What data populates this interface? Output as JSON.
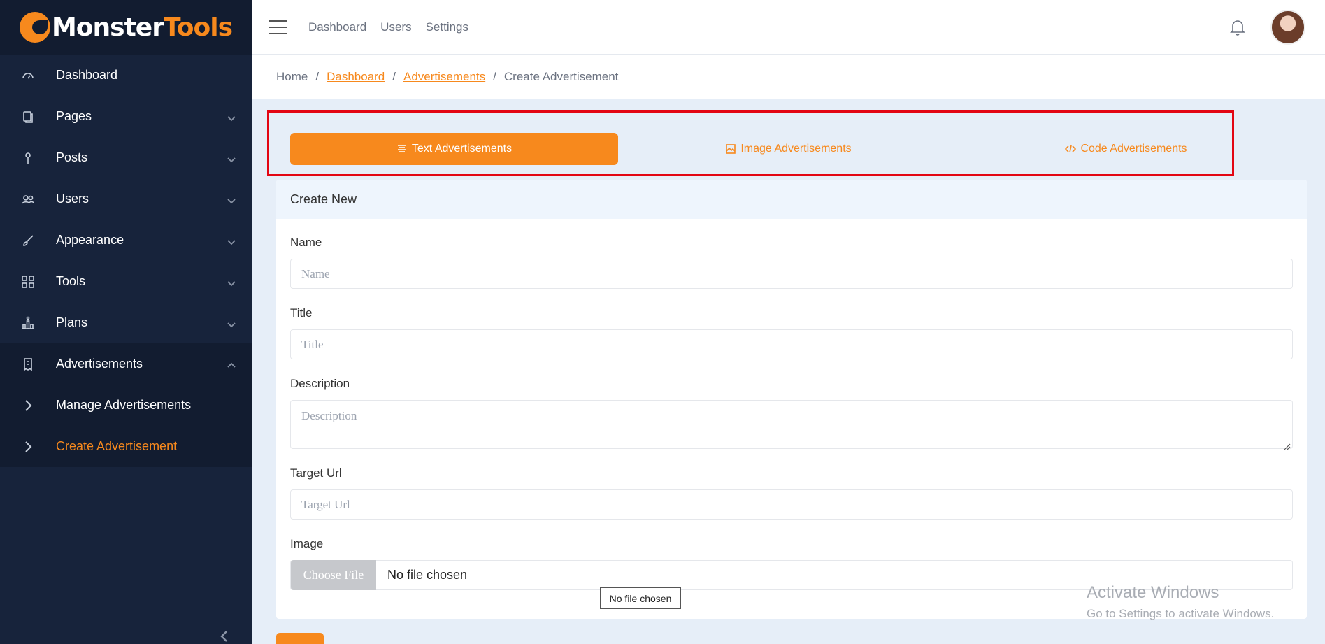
{
  "brand": {
    "part1": "Monster",
    "part2": "Tools"
  },
  "sidebar": {
    "items": [
      {
        "label": "Dashboard",
        "icon": "dashboard-icon"
      },
      {
        "label": "Pages",
        "icon": "pages-icon"
      },
      {
        "label": "Posts",
        "icon": "posts-icon"
      },
      {
        "label": "Users",
        "icon": "users-icon"
      },
      {
        "label": "Appearance",
        "icon": "brush-icon"
      },
      {
        "label": "Tools",
        "icon": "grid-icon"
      },
      {
        "label": "Plans",
        "icon": "plans-icon"
      },
      {
        "label": "Advertisements",
        "icon": "receipt-icon"
      }
    ],
    "sub_items": [
      {
        "label": "Manage Advertisements"
      },
      {
        "label": "Create Advertisement"
      }
    ]
  },
  "topbar": {
    "links": [
      "Dashboard",
      "Users",
      "Settings"
    ]
  },
  "breadcrumb": {
    "home": "Home",
    "dashboard": "Dashboard",
    "ads": "Advertisements",
    "current": "Create Advertisement",
    "separator": "/"
  },
  "tabs": [
    {
      "label": "Text Advertisements",
      "active": true
    },
    {
      "label": "Image Advertisements",
      "active": false
    },
    {
      "label": "Code Advertisements",
      "active": false
    }
  ],
  "form": {
    "header": "Create New",
    "name": {
      "label": "Name",
      "placeholder": "Name"
    },
    "title": {
      "label": "Title",
      "placeholder": "Title"
    },
    "description": {
      "label": "Description",
      "placeholder": "Description"
    },
    "target_url": {
      "label": "Target Url",
      "placeholder": "Target Url"
    },
    "image": {
      "label": "Image",
      "button": "Choose File",
      "status": "No file chosen",
      "tooltip": "No file chosen"
    }
  },
  "watermark": {
    "line1": "Activate Windows",
    "line2": "Go to Settings to activate Windows."
  },
  "colors": {
    "accent": "#f7891d",
    "sidebar": "#17233b",
    "highlight": "#e30613"
  }
}
